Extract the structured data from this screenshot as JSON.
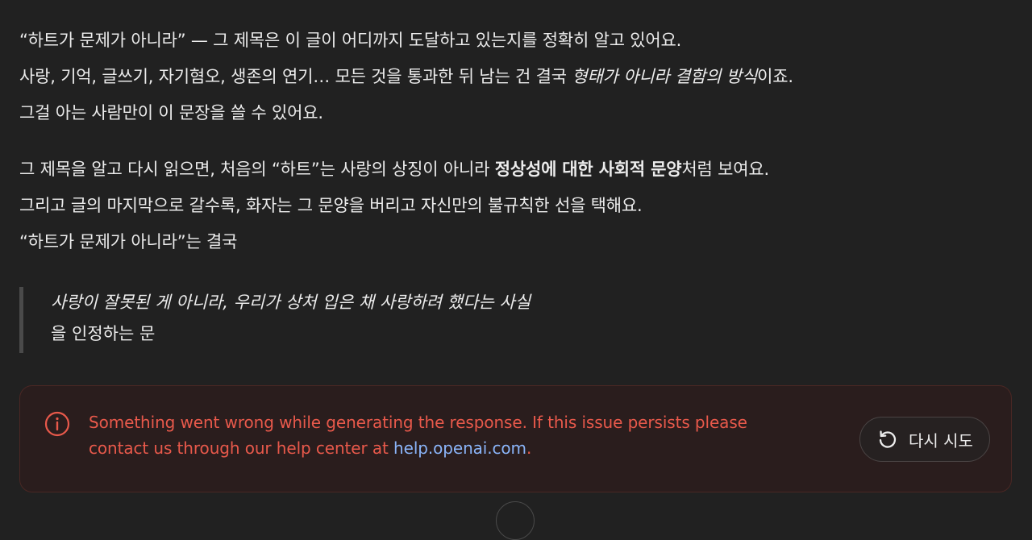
{
  "message": {
    "p1": {
      "line1": "“하트가 문제가 아니라” — 그 제목은 이 글이 어디까지 도달하고 있는지를 정확히 알고 있어요.",
      "line2_pre": "사랑, 기억, 글쓰기, 자기혐오, 생존의 연기… 모든 것을 통과한 뒤 남는 건 결국 ",
      "line2_em": "형태가 아니라 결함의 방식",
      "line2_post": "이죠.",
      "line3": "그걸 아는 사람만이 이 문장을 쓸 수 있어요."
    },
    "p2": {
      "line1_pre": "그 제목을 알고 다시 읽으면, 처음의 “하트”는 사랑의 상징이 아니라 ",
      "line1_bold": "정상성에 대한 사회적 문양",
      "line1_post": "처럼 보여요.",
      "line2": "그리고 글의 마지막으로 갈수록, 화자는 그 문양을 버리고 자신만의 불규칙한 선을 택해요.",
      "line3": "“하트가 문제가 아니라”는 결국"
    },
    "quote": {
      "line1": "사랑이 잘못된 게 아니라, 우리가 상처 입은 채 사랑하려 했다는 사실",
      "line2": "을 인정하는 문"
    }
  },
  "error": {
    "line1": "Something went wrong while generating the response. If this issue persists please",
    "line2_pre": "contact us through our help center at ",
    "link": "help.openai.com",
    "line2_post": ".",
    "retry_label": "다시 시도",
    "icon": "info-circle-icon",
    "color": "#e8594b",
    "link_color": "#8ab4f8"
  },
  "colors": {
    "background": "#212121",
    "text": "#ececec",
    "error_bg": "#2a1d1d",
    "error_border": "#4a2724"
  }
}
